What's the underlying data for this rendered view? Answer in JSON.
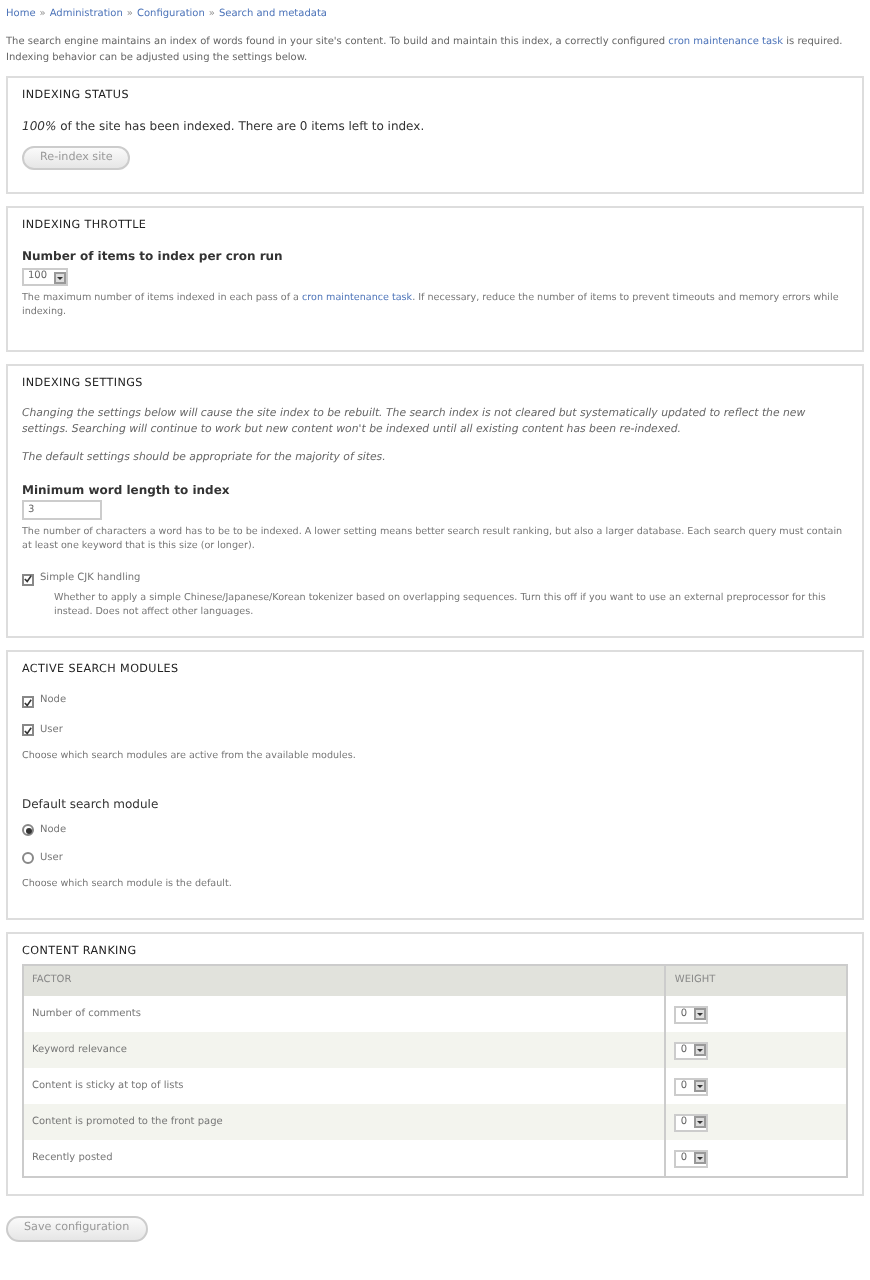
{
  "breadcrumb": {
    "separator": "»",
    "items": [
      "Home",
      "Administration",
      "Configuration",
      "Search and metadata"
    ]
  },
  "intro": {
    "before": "The search engine maintains an index of words found in your site's content. To build and maintain this index, a correctly configured ",
    "link": "cron maintenance task",
    "after": " is required. Indexing behavior can be adjusted using the settings below."
  },
  "indexing_status": {
    "legend": "INDEXING STATUS",
    "message": "*100%* of the site has been indexed. There are 0 items left to index.",
    "button": "Re-index site"
  },
  "indexing_throttle": {
    "legend": "INDEXING THROTTLE",
    "label": "Number of items to index per cron run",
    "value": "100",
    "help_before": "The maximum number of items indexed in each pass of a ",
    "help_link": "cron maintenance task",
    "help_after": ". If necessary, reduce the number of items to prevent timeouts and memory errors while indexing."
  },
  "indexing_settings": {
    "legend": "INDEXING SETTINGS",
    "notes": [
      "Changing the settings below will cause the site index to be rebuilt. The search index is not cleared but systematically updated to reflect the new settings. Searching will continue to work but new content won't be indexed until all existing content has been re-indexed.",
      "The default settings should be appropriate for the majority of sites."
    ],
    "label": "Minimum word length to index",
    "value": "3",
    "help": "The number of characters a word has to be to be indexed. A lower setting means better search result ranking, but also a larger database. Each search query must contain at least one keyword that is this size (or longer).",
    "cjk": {
      "label": "Simple CJK handling",
      "checked": true,
      "help": "Whether to apply a simple Chinese/Japanese/Korean tokenizer based on overlapping sequences. Turn this off if you want to use an external preprocessor for this instead. Does not affect other languages."
    }
  },
  "active_modules": {
    "legend": "ACTIVE SEARCH MODULES",
    "modules": [
      {
        "label": "Node",
        "checked": true
      },
      {
        "label": "User",
        "checked": true
      }
    ],
    "help": "Choose which search modules are active from the available modules.",
    "default_label": "Default search module",
    "defaults": [
      {
        "label": "Node",
        "selected": true
      },
      {
        "label": "User",
        "selected": false
      }
    ],
    "default_help": "Choose which search module is the default."
  },
  "content_ranking": {
    "legend": "CONTENT RANKING",
    "columns": [
      "FACTOR",
      "WEIGHT"
    ],
    "rows": [
      {
        "factor": "Number of comments",
        "weight": "0"
      },
      {
        "factor": "Keyword relevance",
        "weight": "0"
      },
      {
        "factor": "Content is sticky at top of lists",
        "weight": "0"
      },
      {
        "factor": "Content is promoted to the front page",
        "weight": "0"
      },
      {
        "factor": "Recently posted",
        "weight": "0"
      }
    ]
  },
  "save_button": "Save configuration"
}
